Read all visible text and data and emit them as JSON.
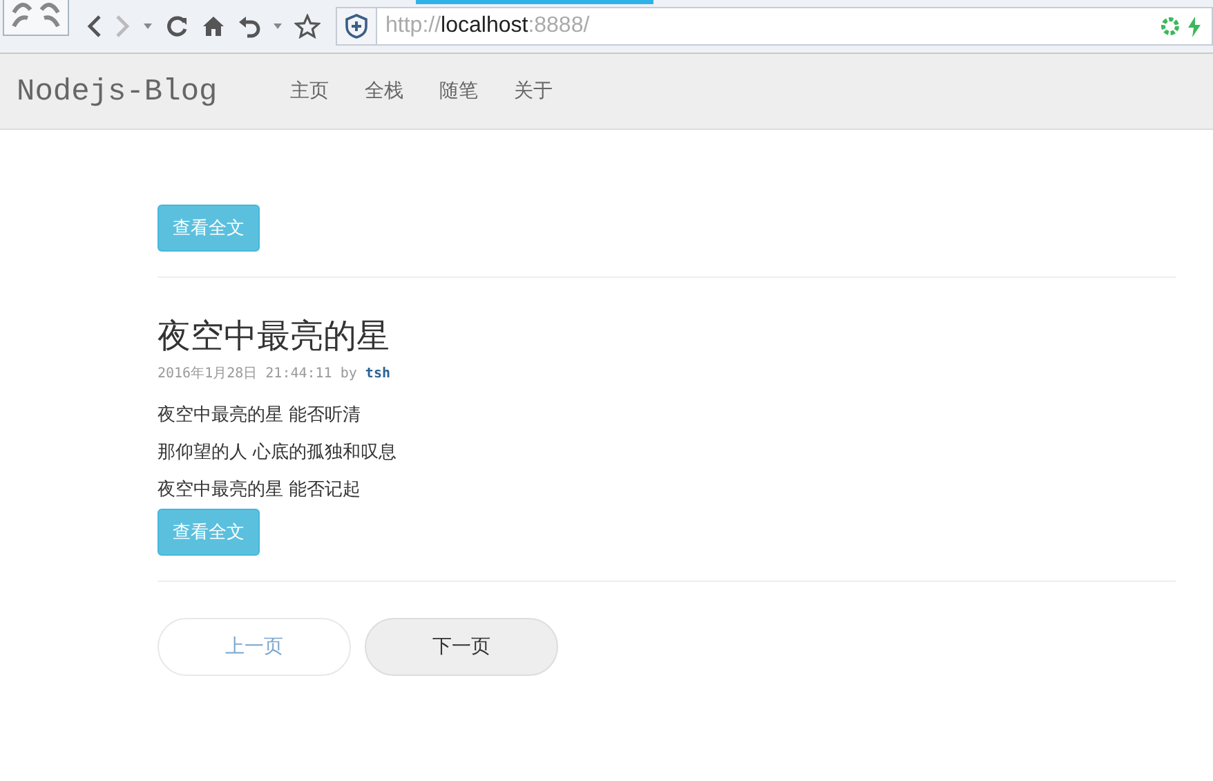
{
  "browser": {
    "address": [
      {
        "text": "http://",
        "kind": "dim"
      },
      {
        "text": "localhost",
        "kind": "host"
      },
      {
        "text": ":8888/",
        "kind": "dim"
      }
    ],
    "loading": true
  },
  "navbar": {
    "brand": "Nodejs-Blog",
    "items": [
      "主页",
      "全栈",
      "随笔",
      "关于"
    ]
  },
  "posts": [
    {
      "read_more": "查看全文"
    },
    {
      "title": "夜空中最亮的星",
      "date": "2016年1月28日 21:44:11",
      "by": "by",
      "author": "tsh",
      "lines": [
        "夜空中最亮的星 能否听清",
        "那仰望的人 心底的孤独和叹息",
        "夜空中最亮的星 能否记起"
      ],
      "read_more": "查看全文"
    }
  ],
  "pager": [
    {
      "label": "上一页",
      "disabled": true
    },
    {
      "label": "下一页",
      "disabled": false
    }
  ]
}
